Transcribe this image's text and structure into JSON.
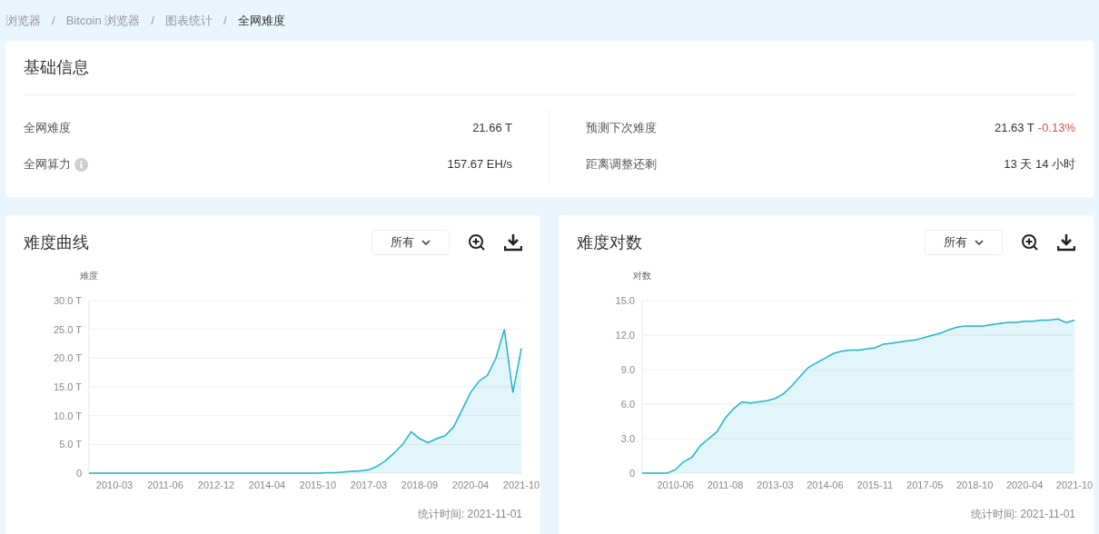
{
  "breadcrumb": {
    "separator": "/",
    "items": [
      {
        "label": "浏览器",
        "current": false
      },
      {
        "label": "Bitcoin 浏览器",
        "current": false
      },
      {
        "label": "图表统计",
        "current": false
      },
      {
        "label": "全网难度",
        "current": true
      }
    ]
  },
  "info": {
    "title": "基础信息",
    "rows": [
      {
        "label": "全网难度",
        "value": "21.66 T",
        "info_icon": false
      },
      {
        "label": "预测下次难度",
        "value": "21.63 T",
        "change": "-0.13%",
        "info_icon": false
      },
      {
        "label": "全网算力",
        "value": "157.67 EH/s",
        "info_icon": true
      },
      {
        "label": "距离调整还剩",
        "value": "13 天 14 小时",
        "info_icon": false
      }
    ]
  },
  "charts": [
    {
      "title": "难度曲线",
      "range": "所有",
      "footnote": "统计时间: 2021-11-01",
      "chart_data": {
        "type": "area",
        "ylabel": "难度",
        "categories": [
          null,
          null,
          null,
          "2010-03",
          null,
          null,
          null,
          null,
          null,
          "2011-06",
          null,
          null,
          null,
          null,
          null,
          "2012-12",
          null,
          null,
          null,
          null,
          null,
          "2014-04",
          null,
          null,
          null,
          null,
          null,
          "2015-10",
          null,
          null,
          null,
          null,
          null,
          "2017-03",
          null,
          null,
          null,
          null,
          null,
          "2018-09",
          null,
          null,
          null,
          null,
          null,
          "2020-04",
          null,
          null,
          null,
          null,
          null,
          "2021-10"
        ],
        "series": [
          {
            "color": "#1fb3cc",
            "values": [
              0,
              0,
              0,
              0,
              0,
              0,
              0,
              0,
              0,
              0,
              0,
              0,
              0,
              0,
              0,
              0,
              0,
              0,
              0,
              0,
              0,
              0,
              0,
              0,
              0,
              0,
              0,
              0,
              0.1,
              0.1,
              0.2,
              0.3,
              0.4,
              0.6,
              1.2,
              2.2,
              3.5,
              5,
              7.2,
              6,
              5.3,
              6,
              6.5,
              8,
              11,
              14,
              16,
              17,
              20,
              25,
              14,
              21.7
            ]
          }
        ],
        "ylim": [
          0,
          30
        ],
        "grid": true,
        "yticks": [
          {
            "value": 0,
            "label": "0"
          },
          {
            "value": 5,
            "label": "5.0 T"
          },
          {
            "value": 10,
            "label": "10.0 T"
          },
          {
            "value": 15,
            "label": "15.0 T"
          },
          {
            "value": 20,
            "label": "20.0 T"
          },
          {
            "value": 25,
            "label": "25.0 T"
          },
          {
            "value": 30,
            "label": "30.0 T"
          }
        ]
      }
    },
    {
      "title": "难度对数",
      "range": "所有",
      "footnote": "统计时间: 2021-11-01",
      "chart_data": {
        "type": "area",
        "ylabel": "对数",
        "categories": [
          null,
          null,
          null,
          null,
          "2010-06",
          null,
          null,
          null,
          null,
          null,
          "2011-08",
          null,
          null,
          null,
          null,
          null,
          "2013-03",
          null,
          null,
          null,
          null,
          null,
          "2014-06",
          null,
          null,
          null,
          null,
          null,
          "2015-11",
          null,
          null,
          null,
          null,
          null,
          "2017-05",
          null,
          null,
          null,
          null,
          null,
          "2018-10",
          null,
          null,
          null,
          null,
          null,
          "2020-04",
          null,
          null,
          null,
          null,
          null,
          "2021-10"
        ],
        "series": [
          {
            "color": "#1fb3cc",
            "values": [
              0,
              0,
              0,
              0,
              0.3,
              1,
              1.4,
              2.4,
              3,
              3.6,
              4.8,
              5.6,
              6.2,
              6.1,
              6.2,
              6.3,
              6.5,
              6.9,
              7.6,
              8.4,
              9.2,
              9.6,
              10,
              10.4,
              10.6,
              10.7,
              10.7,
              10.8,
              10.9,
              11.2,
              11.3,
              11.4,
              11.5,
              11.6,
              11.8,
              12,
              12.2,
              12.5,
              12.7,
              12.8,
              12.8,
              12.8,
              12.9,
              13,
              13.1,
              13.1,
              13.2,
              13.2,
              13.3,
              13.3,
              13.4,
              13.1,
              13.3
            ]
          }
        ],
        "ylim": [
          0,
          15
        ],
        "grid": true,
        "yticks": [
          {
            "value": 0,
            "label": "0"
          },
          {
            "value": 3,
            "label": "3.0"
          },
          {
            "value": 6,
            "label": "6.0"
          },
          {
            "value": 9,
            "label": "9.0"
          },
          {
            "value": 12,
            "label": "12.0"
          },
          {
            "value": 15,
            "label": "15.0"
          }
        ]
      }
    }
  ]
}
